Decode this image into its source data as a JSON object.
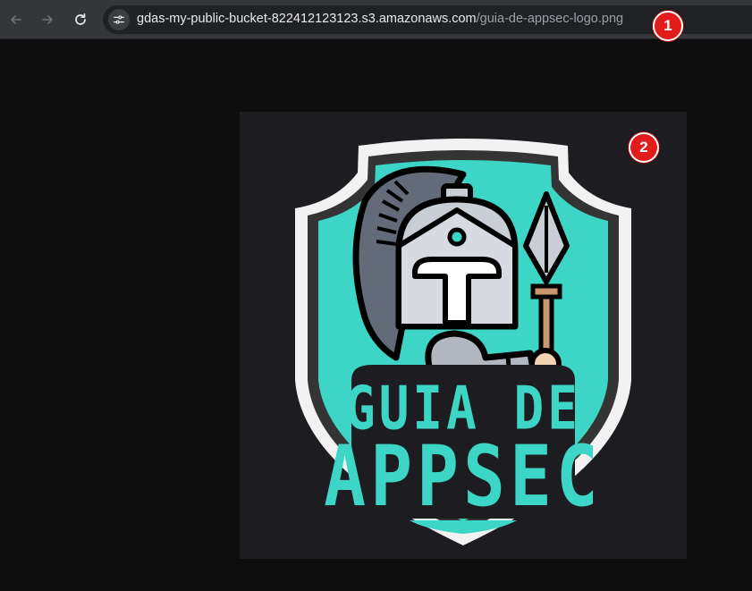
{
  "browser": {
    "url_host": "gdas-my-public-bucket-822412123123.s3.amazonaws.com",
    "url_path": "/guia-de-appsec-logo.png",
    "icons": {
      "back": "arrow-left-icon",
      "forward": "arrow-right-icon",
      "reload": "reload-icon",
      "site_info": "site-settings-icon"
    }
  },
  "annotations": {
    "badge1": "1",
    "badge2": "2"
  },
  "logo": {
    "line1": "GUIA DE",
    "line2": "APPSEC",
    "colors": {
      "teal": "#3dd6c6",
      "background": "#1d1c21",
      "shield_rim": "#f2f2f2",
      "helmet": "#c9cdd4",
      "badge_red": "#e21b1b"
    }
  }
}
